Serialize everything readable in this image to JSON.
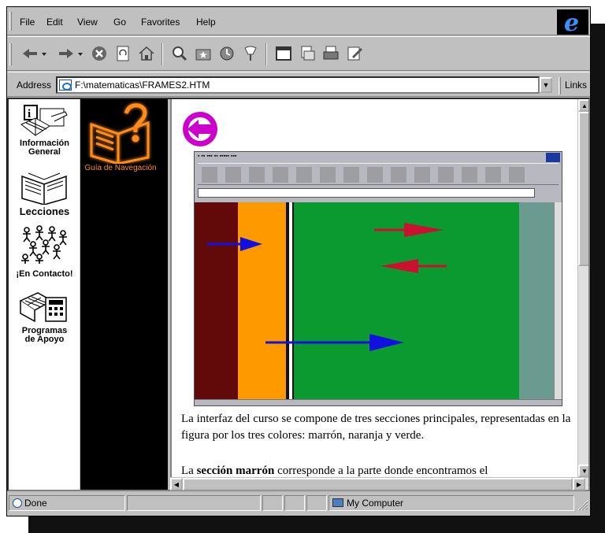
{
  "menu": {
    "items": [
      {
        "label": "File"
      },
      {
        "label": "Edit"
      },
      {
        "label": "View"
      },
      {
        "label": "Go"
      },
      {
        "label": "Favorites"
      },
      {
        "label": "Help"
      }
    ]
  },
  "address": {
    "label": "Address",
    "url": "F:\\matematicas\\FRAMES2.HTM",
    "links_label": "Links"
  },
  "nav": {
    "items": [
      {
        "label1": "Información",
        "label2": "General",
        "icon": "information-icon"
      },
      {
        "label1": "Lecciones",
        "label2": "",
        "icon": "book-icon"
      },
      {
        "label1": "¡En Contacto!",
        "label2": "",
        "icon": "people-icon"
      },
      {
        "label1": "Programas",
        "label2": "de Apoyo",
        "icon": "calculator-icon"
      }
    ],
    "guide_label": "Guía de Navegación"
  },
  "content": {
    "paragraph1": "La interfaz del curso se compone de tres secciones principales, representadas en la figura por los tres colores: marrón, naranja y verde.",
    "paragraph2_bold": "sección marrón",
    "paragraph2_prefix": "La",
    "paragraph2_suffix": "corresponde a la parte donde encontramos el"
  },
  "status": {
    "text": "Done",
    "zone": "My Computer"
  },
  "colors": {
    "brown": "#620a0a",
    "orange": "#ff9900",
    "green": "#0a9a30",
    "back_arrow": "#cc00cc"
  }
}
